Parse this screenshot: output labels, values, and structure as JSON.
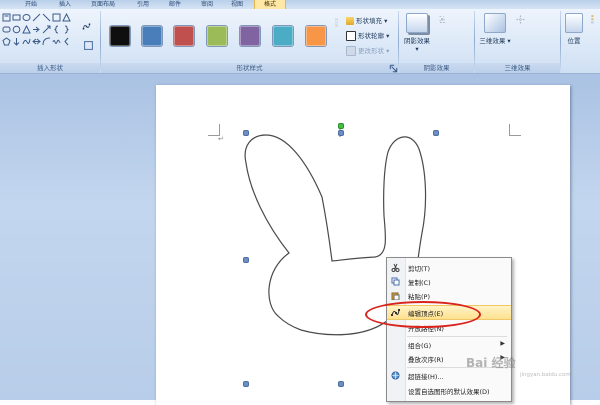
{
  "ribbon": {
    "tabs": [
      "开始",
      "插入",
      "页面布局",
      "引用",
      "邮件",
      "审阅",
      "视图",
      "格式"
    ],
    "active_tab": "格式",
    "groups": {
      "insert_shapes": "插入形状",
      "shape_styles": "形状样式",
      "shadow_effects": "阴影效果",
      "threed_effects": "三维效果"
    },
    "shape_fill": "形状填充",
    "shape_outline": "形状轮廓",
    "change_shape": "更改形状",
    "shadow_button": "阴影效果",
    "threed_button": "三维效果",
    "position_button": "位置",
    "swatch_colors": [
      "#0f0f0f",
      "#4a7ebb",
      "#c0504d",
      "#9bbb59",
      "#8064a2",
      "#4bacc6",
      "#f79646"
    ]
  },
  "context_menu": {
    "items": [
      {
        "label": "剪切(T)",
        "icon": "scissors-icon"
      },
      {
        "label": "复制(C)",
        "icon": "copy-icon"
      },
      {
        "label": "粘贴(P)",
        "icon": "paste-icon"
      },
      {
        "label": "编辑顶点(E)",
        "icon": "edit-points-icon"
      },
      {
        "label": "开放路径(N)",
        "icon": ""
      },
      {
        "label": "组合(G)",
        "icon": ""
      },
      {
        "label": "叠放次序(R)",
        "icon": ""
      },
      {
        "label": "超链接(H)...",
        "icon": "hyperlink-icon"
      },
      {
        "label": "设置自选图形的默认效果(D)",
        "icon": ""
      }
    ],
    "highlighted": "编辑顶点(E)"
  },
  "watermark": {
    "text": "Bai 经验",
    "sub": "jingyan.baidu.com"
  }
}
